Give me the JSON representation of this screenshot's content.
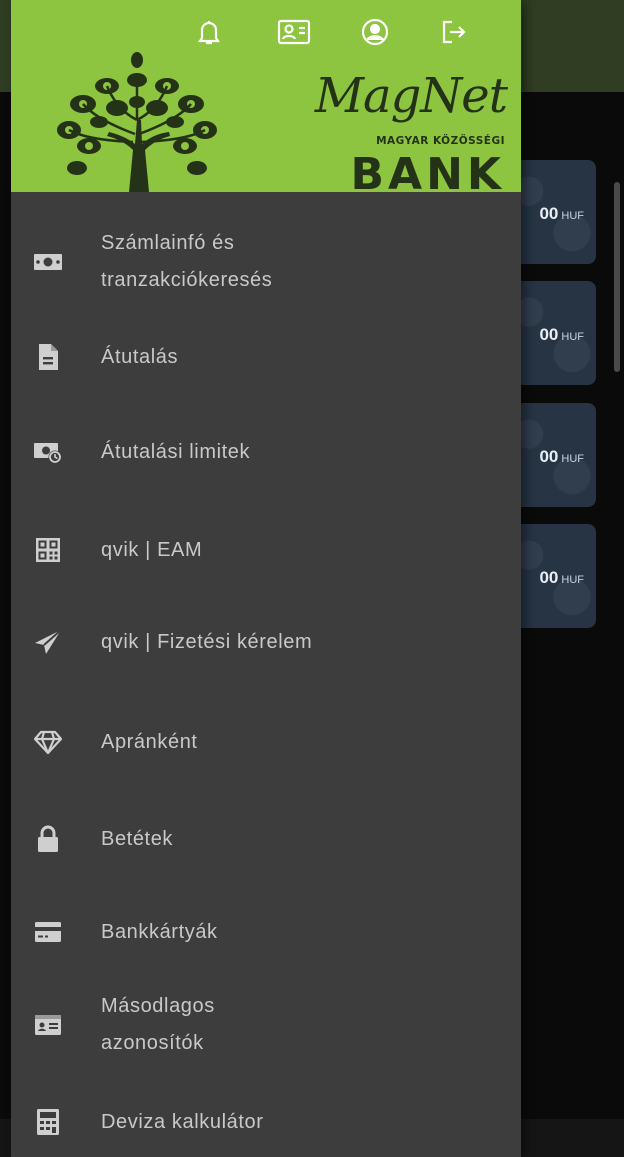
{
  "background": {
    "amounts": [
      {
        "value": "00",
        "currency": "HUF"
      },
      {
        "value": "00",
        "currency": "HUF"
      },
      {
        "value": "00",
        "currency": "HUF"
      },
      {
        "value": "00",
        "currency": "HUF"
      }
    ]
  },
  "header": {
    "icons": [
      "bell-icon",
      "contact-card-icon",
      "account-circle-icon",
      "logout-icon"
    ],
    "brand": {
      "name": "MagNet",
      "tagline": "MAGYAR KÖZÖSSÉGI",
      "bank": "BANK"
    },
    "colors": {
      "header_bg": "#8dc440",
      "brand_text": "#243318"
    }
  },
  "menu": {
    "items": [
      {
        "label": "Számlainfó és\ntranzakciókeresés",
        "icon": "money-bill-icon"
      },
      {
        "label": "Átutalás",
        "icon": "document-icon"
      },
      {
        "label": "Átutalási limitek",
        "icon": "money-limit-icon"
      },
      {
        "label": "qvik | EAM",
        "icon": "qr-code-icon"
      },
      {
        "label": "qvik | Fizetési kérelem",
        "icon": "paper-plane-icon"
      },
      {
        "label": "Apránként",
        "icon": "diamond-icon"
      },
      {
        "label": "Betétek",
        "icon": "lock-icon"
      },
      {
        "label": "Bankkártyák",
        "icon": "credit-card-icon"
      },
      {
        "label": "Másodlagos\nazonosítók",
        "icon": "id-card-icon"
      },
      {
        "label": "Deviza kalkulátor",
        "icon": "calculator-icon"
      }
    ]
  },
  "colors": {
    "drawer_bg": "#3d3d3d",
    "menu_text": "#c9c9c9",
    "icon": "#cfcfcf"
  }
}
